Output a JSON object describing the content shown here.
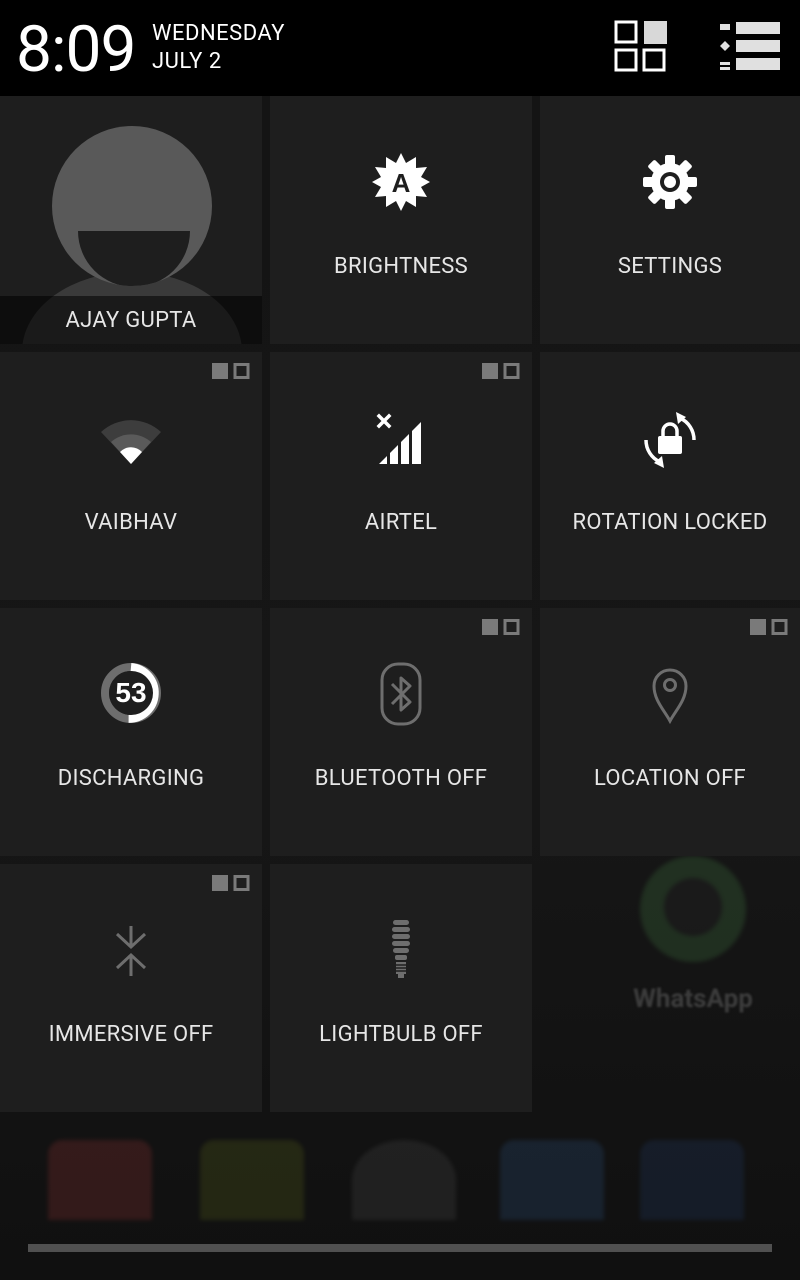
{
  "header": {
    "time": "8:09",
    "day": "WEDNESDAY",
    "date": "JULY 2"
  },
  "tiles": {
    "user": {
      "label": "AJAY GUPTA"
    },
    "brightness": {
      "label": "BRIGHTNESS",
      "icon": "brightness-auto-icon"
    },
    "settings": {
      "label": "SETTINGS",
      "icon": "gear-icon"
    },
    "wifi": {
      "label": "VAIBHAV",
      "icon": "wifi-icon"
    },
    "mobile": {
      "label": "AIRTEL",
      "icon": "signal-icon"
    },
    "rotation": {
      "label": "ROTATION LOCKED",
      "icon": "rotation-lock-icon"
    },
    "battery": {
      "label": "DISCHARGING",
      "level": "53",
      "icon": "battery-ring-icon"
    },
    "bluetooth": {
      "label": "BLUETOOTH OFF",
      "icon": "bluetooth-icon"
    },
    "location": {
      "label": "LOCATION OFF",
      "icon": "location-pin-icon"
    },
    "immersive": {
      "label": "IMMERSIVE OFF",
      "icon": "immersive-icon"
    },
    "lightbulb": {
      "label": "LIGHTBULB OFF",
      "icon": "lightbulb-icon"
    }
  },
  "background": {
    "app_label": "WhatsApp"
  },
  "colors": {
    "tile_bg": "#1e1e1e",
    "header_bg": "#000000",
    "label_text": "#e6e6e6"
  }
}
